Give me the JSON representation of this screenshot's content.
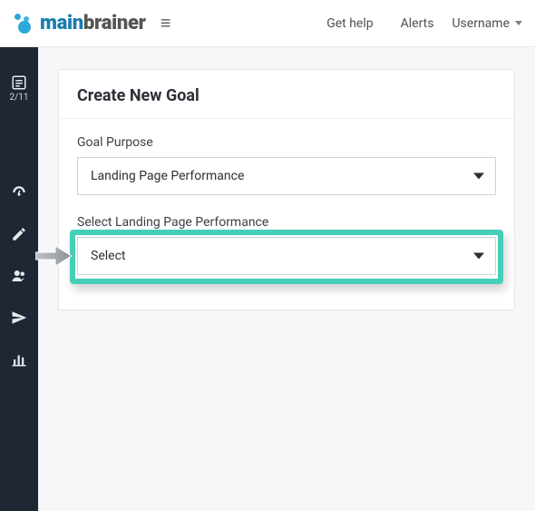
{
  "header": {
    "brand_a": "main",
    "brand_b": "brainer",
    "get_help": "Get help",
    "alerts": "Alerts",
    "username": "Username"
  },
  "sidebar": {
    "step_label": "2/11"
  },
  "card": {
    "title": "Create New Goal",
    "goal_purpose_label": "Goal Purpose",
    "goal_purpose_value": "Landing Page Performance",
    "select_lpp_label": "Select Landing Page Performance",
    "select_lpp_value": "Select"
  }
}
